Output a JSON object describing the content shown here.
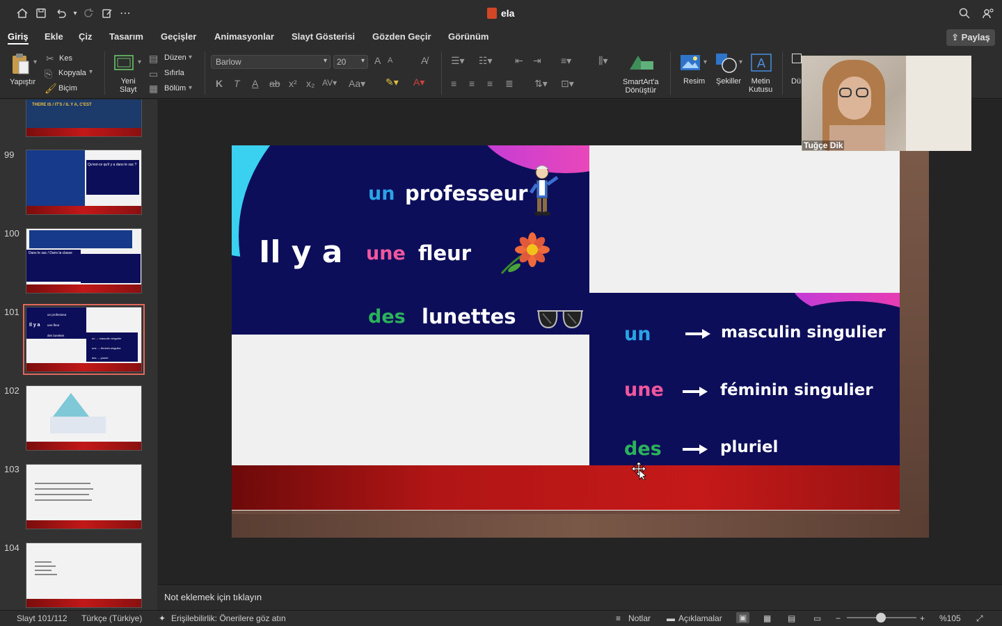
{
  "window": {
    "title": "ela",
    "icons": [
      "home-icon",
      "save-icon",
      "undo-icon",
      "redo-icon",
      "touch-mode-icon",
      "more-icon",
      "search-icon",
      "collaborate-icon"
    ]
  },
  "menu": {
    "tabs": [
      "Giriş",
      "Ekle",
      "Çiz",
      "Tasarım",
      "Geçişler",
      "Animasyonlar",
      "Slayt Gösterisi",
      "Gözden Geçir",
      "Görünüm"
    ],
    "active": "Giriş",
    "share_label": "Paylaş"
  },
  "ribbon": {
    "paste_label": "Yapıştır",
    "cut_label": "Kes",
    "copy_label": "Kopyala",
    "format_label": "Biçim",
    "new_slide_line1": "Yeni",
    "new_slide_line2": "Slayt",
    "layout_label": "Düzen",
    "reset_label": "Sıfırla",
    "section_label": "Bölüm",
    "font_name": "Barlow",
    "font_size": "20",
    "bold_glyph": "K",
    "italic_glyph": "T",
    "smartart_line1": "SmartArt'a",
    "smartart_line2": "Dönüştür",
    "picture_label": "Resim",
    "shapes_label": "Şekiller",
    "textbox_line1": "Metin",
    "textbox_line2": "Kutusu",
    "arrange_label": "Dü"
  },
  "sidebar": {
    "thumbnails": [
      {
        "number": "",
        "top_text": "THERE IS / IT'S  /  IL Y A, C'EST"
      },
      {
        "number": "99",
        "top_text": "Qu'est-ce qu'il y a dans le sac ?"
      },
      {
        "number": "100",
        "top_text": "Dans le sac / Dans la classe"
      },
      {
        "number": "101",
        "top_text": "Il y a"
      },
      {
        "number": "102",
        "top_text": ""
      },
      {
        "number": "103",
        "top_text": ""
      },
      {
        "number": "104",
        "top_text": ""
      }
    ],
    "selected": "101"
  },
  "slide": {
    "il_y_a": "Il y a",
    "rows_left": [
      {
        "article": "un",
        "noun": "professeur"
      },
      {
        "article": "une",
        "noun": "fleur"
      },
      {
        "article": "des",
        "noun": "lunettes"
      }
    ],
    "rows_right": [
      {
        "article": "un",
        "meaning": "masculin singulier"
      },
      {
        "article": "une",
        "meaning": "féminin singulier"
      },
      {
        "article": "des",
        "meaning": "pluriel"
      }
    ]
  },
  "thumb101": {
    "row1": "un  professeur",
    "row2": "une  fleur",
    "row3": "des  lunettes",
    "il_y_a": "Il y a",
    "r1": "un → masculin singulier",
    "r2": "une → féminin singulier",
    "r3": "des → pluriel"
  },
  "video": {
    "participant_name": "Tuğçe Dik"
  },
  "notes": {
    "placeholder": "Not eklemek için tıklayın"
  },
  "status": {
    "slide_counter": "Slayt 101/112",
    "language": "Türkçe (Türkiye)",
    "accessibility": "Erişilebilirlik: Önerilere göz atın",
    "notes_label": "Notlar",
    "comments_label": "Açıklamalar",
    "zoom": "%105"
  },
  "colors": {
    "navy": "#0d0e5a",
    "article_blue": "#2aa3e6",
    "article_pink": "#f0579e",
    "article_green": "#2bb35a",
    "selection_outline": "#e3685e"
  }
}
